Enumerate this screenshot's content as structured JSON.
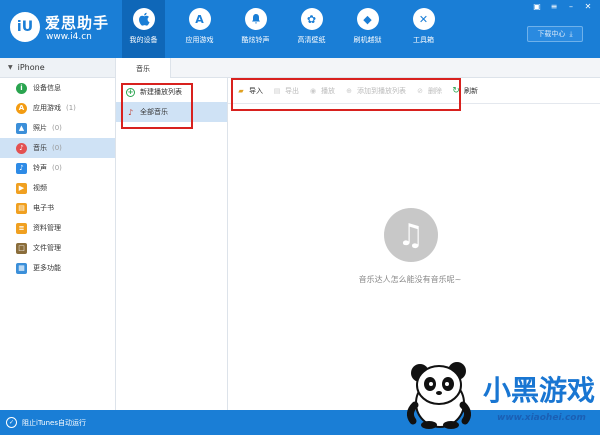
{
  "brand": {
    "name": "爱思助手",
    "url": "www.i4.cn",
    "logo_glyph": "iU"
  },
  "nav": {
    "items": [
      {
        "label": "我的设备",
        "icon": "apple-icon",
        "glyph": ""
      },
      {
        "label": "应用游戏",
        "icon": "app-store-icon",
        "glyph": "A"
      },
      {
        "label": "酷炫铃声",
        "icon": "bell-icon",
        "glyph": "♪"
      },
      {
        "label": "高清壁纸",
        "icon": "flower-icon",
        "glyph": "✿"
      },
      {
        "label": "刷机越狱",
        "icon": "dropbox-icon",
        "glyph": "◆"
      },
      {
        "label": "工具箱",
        "icon": "tools-icon",
        "glyph": "✕"
      }
    ],
    "active_index": 0
  },
  "window": {
    "download_label": "下载中心"
  },
  "device": {
    "name": "iPhone"
  },
  "sidebar": {
    "items": [
      {
        "label": "设备信息",
        "count": "",
        "icon": "info-icon",
        "color": "#2aa44f",
        "glyph": "i"
      },
      {
        "label": "应用游戏",
        "count": "(1)",
        "icon": "apps-icon",
        "color": "#f39c12",
        "glyph": "A"
      },
      {
        "label": "照片",
        "count": "(0)",
        "icon": "photo-icon",
        "color": "#3b8fd9",
        "glyph": "▲"
      },
      {
        "label": "音乐",
        "count": "(0)",
        "icon": "music-icon",
        "color": "#e35151",
        "glyph": "♪"
      },
      {
        "label": "铃声",
        "count": "(0)",
        "icon": "bell-icon",
        "color": "#2e8be6",
        "glyph": "♪"
      },
      {
        "label": "视频",
        "count": "",
        "icon": "video-icon",
        "color": "#f0a020",
        "glyph": "▶"
      },
      {
        "label": "电子书",
        "count": "",
        "icon": "book-icon",
        "color": "#f0a020",
        "glyph": "▤"
      },
      {
        "label": "资料管理",
        "count": "",
        "icon": "contacts-icon",
        "color": "#f0a020",
        "glyph": "≡"
      },
      {
        "label": "文件管理",
        "count": "",
        "icon": "file-icon",
        "color": "#8a6d3b",
        "glyph": "□"
      },
      {
        "label": "更多功能",
        "count": "",
        "icon": "grid-icon",
        "color": "#3b8fd9",
        "glyph": "▦"
      }
    ],
    "active_index": 3
  },
  "tab": {
    "label": "音乐"
  },
  "playlists": {
    "new_label": "新建播放列表",
    "all_label": "全部音乐"
  },
  "toolbar": {
    "import_label": "导入",
    "export_label": "导出",
    "play_label": "播放",
    "add_to_playlist_label": "添加到播放列表",
    "delete_label": "删除",
    "refresh_label": "刷新"
  },
  "empty_state": {
    "message": "音乐达人怎么能没有音乐呢~"
  },
  "status": {
    "label": "阻止iTunes自动运行"
  },
  "watermark": {
    "brand": "小黑游戏",
    "url": "www.xiaohei.com"
  },
  "colors": {
    "brand_blue": "#1a7ed6",
    "highlight_red": "#d8211e",
    "selection_blue": "#cfe2f5"
  }
}
